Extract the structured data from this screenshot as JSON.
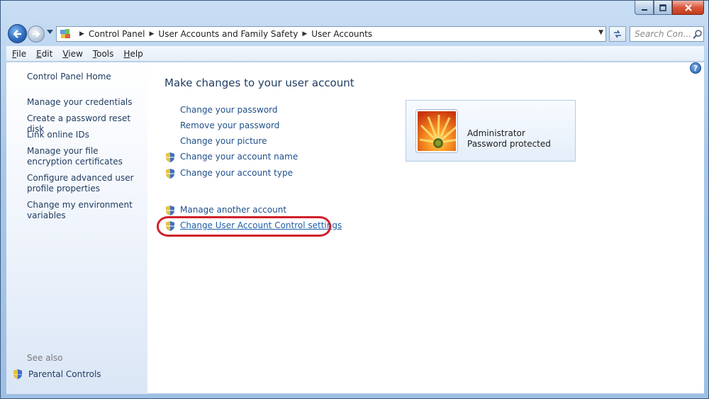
{
  "window": {
    "buttons": {
      "minimize": "minimize",
      "maximize": "maximize",
      "close": "close"
    }
  },
  "address": {
    "crumbs": [
      "Control Panel",
      "User Accounts and Family Safety",
      "User Accounts"
    ],
    "search_placeholder": "Search Con..."
  },
  "menu": [
    "File",
    "Edit",
    "View",
    "Tools",
    "Help"
  ],
  "sidebar": {
    "home": "Control Panel Home",
    "items": [
      "Manage your credentials",
      "Create a password reset disk",
      "Link online IDs",
      "Manage your file encryption certificates",
      "Configure advanced user profile properties",
      "Change my environment variables"
    ],
    "see_also_label": "See also",
    "see_also_items": [
      "Parental Controls"
    ]
  },
  "main": {
    "heading": "Make changes to your user account",
    "tasks": [
      {
        "label": "Change your password",
        "shield": false
      },
      {
        "label": "Remove your password",
        "shield": false
      },
      {
        "label": "Change your picture",
        "shield": false
      },
      {
        "label": "Change your account name",
        "shield": true
      },
      {
        "label": "Change your account type",
        "shield": true
      }
    ],
    "other_tasks": [
      {
        "label": "Manage another account",
        "shield": true
      },
      {
        "label": "Change User Account Control settings",
        "shield": true,
        "highlighted": true
      }
    ]
  },
  "account": {
    "name": "Administrator",
    "status": "Password protected"
  },
  "colors": {
    "link": "#1e4f8a",
    "highlight_circle": "#d0202a",
    "frame": "#a9c8ea"
  }
}
